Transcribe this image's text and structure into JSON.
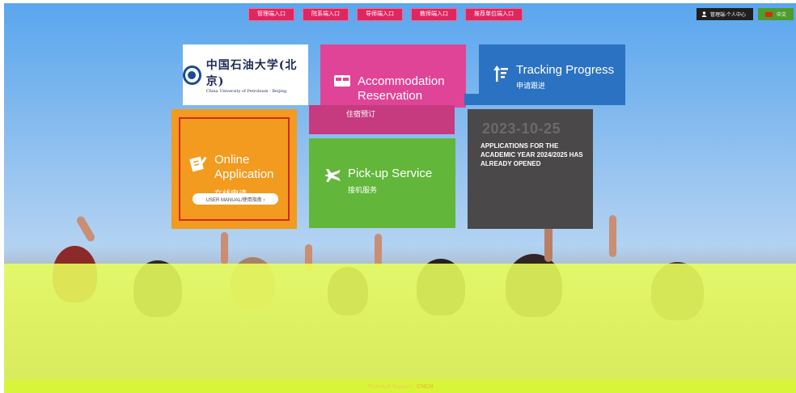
{
  "nav": {
    "buttons": [
      "管理端入口",
      "院系端入口",
      "导师端入口",
      "教师端入口",
      "推荐单位端入口"
    ]
  },
  "header": {
    "user_label": "管理端-个人中心",
    "lang_label": "中文"
  },
  "logo": {
    "cn": "中国石油大学(北京)",
    "en": "China University of Petroleum - Beijing"
  },
  "tiles": {
    "accommodation": {
      "title_line1": "Accommodation",
      "title_line2": "Reservation",
      "sub": "住宿预订"
    },
    "tracking": {
      "title": "Tracking Progress",
      "sub": "申请跟进"
    },
    "online": {
      "title_line1": "Online",
      "title_line2": "Application",
      "sub": "在线申请",
      "manual": "USER MANUAL/使用指南 ›"
    },
    "pickup": {
      "title": "Pick-up Service",
      "sub": "接机服务"
    },
    "news": {
      "date": "2023-10-25",
      "text": "APPLICATIONS FOR THE ACADEMIC YEAR 2024/2025 HAS ALREADY OPENED"
    }
  },
  "footer": {
    "label": "Technical Support:",
    "link": "CNCN"
  },
  "colors": {
    "nav_pink": "#e0265e",
    "accommodation": "#e04497",
    "tracking": "#2b72c2",
    "online": "#f29b1e",
    "pickup": "#62b63a",
    "news": "#4a4848",
    "footer_band": "#d9f53a"
  },
  "icons": {
    "user": "user-icon",
    "flag": "china-flag-icon",
    "bed": "bed-icon",
    "sort": "sort-progress-icon",
    "doc": "document-pen-icon",
    "plane": "airplane-icon"
  }
}
